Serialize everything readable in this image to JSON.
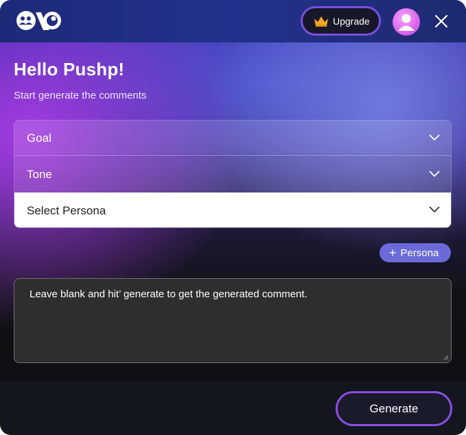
{
  "header": {
    "logo_text": "OVO",
    "upgrade_label": "Upgrade",
    "icons": [
      "logo-icon",
      "crown-icon",
      "user-avatar-icon",
      "close-icon"
    ]
  },
  "main": {
    "greeting": "Hello Pushp!",
    "subtitle": "Start generate the comments",
    "selects": [
      {
        "label": "Goal"
      },
      {
        "label": "Tone"
      },
      {
        "label": "Select Persona"
      }
    ],
    "add_persona_label": "Persona",
    "comment_placeholder": "Leave blank and hit’ generate to get the generated comment."
  },
  "footer": {
    "generate_label": "Generate"
  },
  "colors": {
    "accent_purple": "#8a4fe3",
    "persona_button": "#6a6ad8",
    "avatar_pink": "#d65be8",
    "crown_gold": "#f5a623"
  }
}
